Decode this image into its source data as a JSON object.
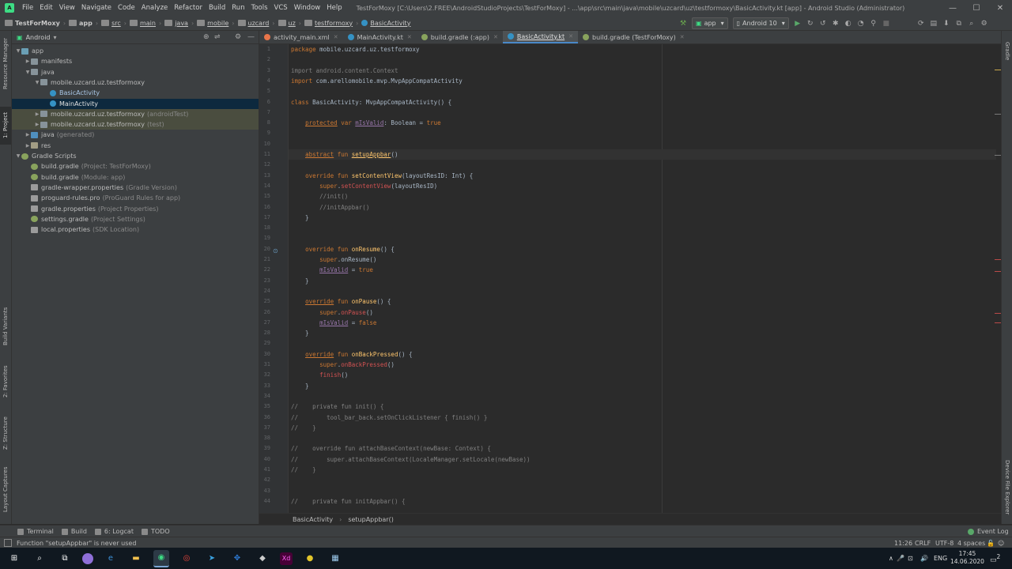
{
  "menubar": {
    "items": [
      "File",
      "Edit",
      "View",
      "Navigate",
      "Code",
      "Analyze",
      "Refactor",
      "Build",
      "Run",
      "Tools",
      "VCS",
      "Window",
      "Help"
    ],
    "title": "TestForMoxy [C:\\Users\\2.FREE\\AndroidStudioProjects\\TestForMoxy] - ...\\app\\src\\main\\java\\mobile\\uzcard\\uz\\testformoxy\\BasicActivity.kt [app] - Android Studio (Administrator)",
    "minimize": "—",
    "maximize": "☐",
    "close": "✕"
  },
  "navbar": {
    "crumbs": [
      "TestForMoxy",
      "app",
      "src",
      "main",
      "java",
      "mobile",
      "uzcard",
      "uz",
      "testformoxy",
      "BasicActivity"
    ],
    "run_config": "app",
    "device": "Android 10"
  },
  "left_tabs": {
    "resource_manager": "Resource Manager",
    "project": "1: Project",
    "build_variants": "Build Variants",
    "favorites": "2: Favorites",
    "structure": "Z: Structure",
    "layout_captures": "Layout Captures"
  },
  "right_tabs": {
    "gradle": "Gradle",
    "device_file_explorer": "Device File Explorer"
  },
  "project": {
    "view": "Android",
    "tree": [
      {
        "label": "app",
        "hint": "",
        "depth": 0,
        "arrow": "▼",
        "icon": "folder-blue"
      },
      {
        "label": "manifests",
        "hint": "",
        "depth": 1,
        "arrow": "▶",
        "icon": "folder"
      },
      {
        "label": "java",
        "hint": "",
        "depth": 1,
        "arrow": "▼",
        "icon": "folder"
      },
      {
        "label": "mobile.uzcard.uz.testformoxy",
        "hint": "",
        "depth": 2,
        "arrow": "▼",
        "icon": "folder"
      },
      {
        "label": "BasicActivity",
        "hint": "",
        "depth": 3,
        "arrow": "",
        "icon": "kt"
      },
      {
        "label": "MainActivity",
        "hint": "",
        "depth": 3,
        "arrow": "",
        "icon": "kt",
        "state": "selected"
      },
      {
        "label": "mobile.uzcard.uz.testformoxy",
        "hint": "(androidTest)",
        "depth": 2,
        "arrow": "▶",
        "icon": "folder",
        "state": "highlight"
      },
      {
        "label": "mobile.uzcard.uz.testformoxy",
        "hint": "(test)",
        "depth": 2,
        "arrow": "▶",
        "icon": "folder",
        "state": "highlight"
      },
      {
        "label": "java",
        "hint": "(generated)",
        "depth": 1,
        "arrow": "▶",
        "icon": "src"
      },
      {
        "label": "res",
        "hint": "",
        "depth": 1,
        "arrow": "▶",
        "icon": "res"
      },
      {
        "label": "Gradle Scripts",
        "hint": "",
        "depth": 0,
        "arrow": "▼",
        "icon": "gradle"
      },
      {
        "label": "build.gradle",
        "hint": "(Project: TestForMoxy)",
        "depth": 1,
        "arrow": "",
        "icon": "gradle"
      },
      {
        "label": "build.gradle",
        "hint": "(Module: app)",
        "depth": 1,
        "arrow": "",
        "icon": "gradle"
      },
      {
        "label": "gradle-wrapper.properties",
        "hint": "(Gradle Version)",
        "depth": 1,
        "arrow": "",
        "icon": "file"
      },
      {
        "label": "proguard-rules.pro",
        "hint": "(ProGuard Rules for app)",
        "depth": 1,
        "arrow": "",
        "icon": "file"
      },
      {
        "label": "gradle.properties",
        "hint": "(Project Properties)",
        "depth": 1,
        "arrow": "",
        "icon": "file"
      },
      {
        "label": "settings.gradle",
        "hint": "(Project Settings)",
        "depth": 1,
        "arrow": "",
        "icon": "gradle"
      },
      {
        "label": "local.properties",
        "hint": "(SDK Location)",
        "depth": 1,
        "arrow": "",
        "icon": "file"
      }
    ]
  },
  "tabs": [
    {
      "label": "activity_main.xml",
      "color": "#e8754a",
      "active": false
    },
    {
      "label": "MainActivity.kt",
      "color": "#3592c4",
      "active": false
    },
    {
      "label": "build.gradle (:app)",
      "color": "#89a35d",
      "active": false
    },
    {
      "label": "BasicActivity.kt",
      "color": "#3592c4",
      "active": true
    },
    {
      "label": "build.gradle (TestForMoxy)",
      "color": "#89a35d",
      "active": false
    }
  ],
  "code": [
    {
      "n": "1",
      "t": [
        [
          "kw",
          "package "
        ],
        [
          "",
          "mobile.uzcard.uz.testformoxy"
        ]
      ]
    },
    {
      "n": "2",
      "t": []
    },
    {
      "n": "3",
      "t": [
        [
          "gray",
          "import android.content.Context"
        ]
      ]
    },
    {
      "n": "4",
      "t": [
        [
          "kw",
          "import "
        ],
        [
          "",
          "com.arellomobile.mvp.MvpAppCompatActivity"
        ]
      ]
    },
    {
      "n": "5",
      "t": []
    },
    {
      "n": "6",
      "t": [
        [
          "kw",
          "class "
        ],
        [
          "",
          "BasicActivity: MvpAppCompatActivity() {"
        ]
      ]
    },
    {
      "n": "7",
      "t": []
    },
    {
      "n": "8",
      "t": [
        [
          "",
          "    "
        ],
        [
          "kw und",
          "protected"
        ],
        [
          "kw",
          " var "
        ],
        [
          "prop und",
          "mIsValid"
        ],
        [
          "",
          ": Boolean = "
        ],
        [
          "kw",
          "true"
        ]
      ]
    },
    {
      "n": "9",
      "t": []
    },
    {
      "n": "10",
      "t": []
    },
    {
      "n": "11",
      "t": [
        [
          "",
          "    "
        ],
        [
          "kw und",
          "abstract"
        ],
        [
          "kw",
          " fun "
        ],
        [
          "fn und",
          "setupAppbar"
        ],
        [
          "",
          "()"
        ]
      ],
      "current": true
    },
    {
      "n": "12",
      "t": []
    },
    {
      "n": "13",
      "t": [
        [
          "",
          "    "
        ],
        [
          "kw",
          "override fun "
        ],
        [
          "fn",
          "setContentView"
        ],
        [
          "",
          "(layoutResID: Int) {"
        ]
      ]
    },
    {
      "n": "14",
      "t": [
        [
          "",
          "        "
        ],
        [
          "kw",
          "super"
        ],
        [
          "",
          "."
        ],
        [
          "err",
          "setContentView"
        ],
        [
          "",
          "(layoutResID)"
        ]
      ]
    },
    {
      "n": "15",
      "t": [
        [
          "cm",
          "        //init()"
        ]
      ]
    },
    {
      "n": "16",
      "t": [
        [
          "cm",
          "        //initAppbar()"
        ]
      ]
    },
    {
      "n": "17",
      "t": [
        [
          "",
          "    }"
        ]
      ]
    },
    {
      "n": "18",
      "t": []
    },
    {
      "n": "19",
      "t": []
    },
    {
      "n": "20",
      "t": [
        [
          "",
          "    "
        ],
        [
          "kw",
          "override fun "
        ],
        [
          "fn",
          "onResume"
        ],
        [
          "",
          "() {"
        ]
      ]
    },
    {
      "n": "21",
      "t": [
        [
          "",
          "        "
        ],
        [
          "kw",
          "super"
        ],
        [
          "",
          ".onResume()"
        ]
      ]
    },
    {
      "n": "22",
      "t": [
        [
          "",
          "        "
        ],
        [
          "prop und",
          "mIsValid"
        ],
        [
          "",
          " = "
        ],
        [
          "kw",
          "true"
        ]
      ]
    },
    {
      "n": "23",
      "t": [
        [
          "",
          "    }"
        ]
      ]
    },
    {
      "n": "24",
      "t": []
    },
    {
      "n": "25",
      "t": [
        [
          "",
          "    "
        ],
        [
          "kw und",
          "override"
        ],
        [
          "kw",
          " fun "
        ],
        [
          "fn",
          "onPause"
        ],
        [
          "",
          "() {"
        ]
      ]
    },
    {
      "n": "26",
      "t": [
        [
          "",
          "        "
        ],
        [
          "kw",
          "super"
        ],
        [
          "",
          "."
        ],
        [
          "err",
          "onPause"
        ],
        [
          "",
          "()"
        ]
      ]
    },
    {
      "n": "27",
      "t": [
        [
          "",
          "        "
        ],
        [
          "prop und",
          "mIsValid"
        ],
        [
          "",
          " = "
        ],
        [
          "kw",
          "false"
        ]
      ]
    },
    {
      "n": "28",
      "t": [
        [
          "",
          "    }"
        ]
      ]
    },
    {
      "n": "29",
      "t": []
    },
    {
      "n": "30",
      "t": [
        [
          "",
          "    "
        ],
        [
          "kw und",
          "override"
        ],
        [
          "kw",
          " fun "
        ],
        [
          "fn",
          "onBackPressed"
        ],
        [
          "",
          "() {"
        ]
      ]
    },
    {
      "n": "31",
      "t": [
        [
          "",
          "        "
        ],
        [
          "kw",
          "super"
        ],
        [
          "",
          "."
        ],
        [
          "err",
          "onBackPressed"
        ],
        [
          "",
          "()"
        ]
      ]
    },
    {
      "n": "32",
      "t": [
        [
          "",
          "        "
        ],
        [
          "err",
          "finish"
        ],
        [
          "",
          "()"
        ]
      ]
    },
    {
      "n": "33",
      "t": [
        [
          "",
          "    }"
        ]
      ]
    },
    {
      "n": "34",
      "t": []
    },
    {
      "n": "35",
      "t": [
        [
          "cm",
          "//    private fun init() {"
        ]
      ]
    },
    {
      "n": "36",
      "t": [
        [
          "cm",
          "//        tool_bar_back.setOnClickListener { finish() }"
        ]
      ]
    },
    {
      "n": "37",
      "t": [
        [
          "cm",
          "//    }"
        ]
      ]
    },
    {
      "n": "38",
      "t": []
    },
    {
      "n": "39",
      "t": [
        [
          "cm",
          "//    override fun attachBaseContext(newBase: Context) {"
        ]
      ]
    },
    {
      "n": "40",
      "t": [
        [
          "cm",
          "//        super.attachBaseContext(LocaleManager.setLocale(newBase))"
        ]
      ]
    },
    {
      "n": "41",
      "t": [
        [
          "cm",
          "//    }"
        ]
      ]
    },
    {
      "n": "42",
      "t": []
    },
    {
      "n": "43",
      "t": []
    },
    {
      "n": "44",
      "t": [
        [
          "cm",
          "//    private fun initAppbar() {"
        ]
      ]
    }
  ],
  "editor_breadcrumb": [
    "BasicActivity",
    "setupAppbar()"
  ],
  "bottom_tabs": {
    "terminal": "Terminal",
    "build": "Build",
    "logcat": "6: Logcat",
    "todo": "TODO",
    "event_log": "Event Log"
  },
  "status": {
    "message": "Function \"setupAppbar\" is never used",
    "position": "11:26",
    "line_sep": "CRLF",
    "encoding": "UTF-8",
    "indent": "4 spaces"
  },
  "taskbar": {
    "lang": "ENG",
    "time": "17:45",
    "date": "14.06.2020",
    "notifications": "2"
  },
  "colors": {
    "accent": "#4a88c7",
    "keyword": "#cc7832",
    "function": "#ffc66d",
    "property": "#9876aa",
    "error": "#d25252",
    "comment": "#808080"
  }
}
